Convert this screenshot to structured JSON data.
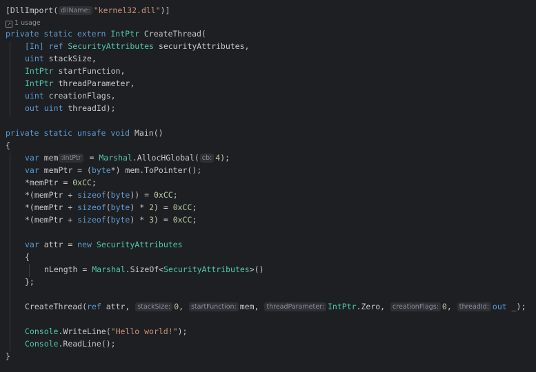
{
  "editor": {
    "attr_open": "[DllImport(",
    "hint_dllname": "dllName:",
    "dll_string": "\"kernel32.dll\"",
    "attr_close": ")]",
    "usage_text": "1 usage",
    "kw_private": "private",
    "kw_static": "static",
    "kw_extern": "extern",
    "kw_unsafe": "unsafe",
    "kw_void": "void",
    "kw_var": "var",
    "kw_ref": "ref",
    "kw_uint": "uint",
    "kw_out": "out",
    "kw_byte": "byte",
    "kw_sizeof": "sizeof",
    "kw_new": "new",
    "type_intptr": "IntPtr",
    "type_security": "SecurityAttributes",
    "type_marshal": "Marshal",
    "type_console": "Console",
    "create_thread_decl": " CreateThread(",
    "in_attr": "[In]",
    "p_security": " securityAttributes,",
    "p_stacksize": " stackSize,",
    "p_startfunction": " startFunction,",
    "p_threadparameter": " threadParameter,",
    "p_creationflags": " creationFlags,",
    "p_threadid": " threadId);",
    "main_sig": " Main()",
    "brace_open": "{",
    "brace_close": "}",
    "mem_name": " mem",
    "hint_intptr": ":IntPtr",
    "eq": " = ",
    "alloc_call": ".AllocHGlobal(",
    "hint_cb": "cb:",
    "num_4": "4",
    "close_semi": ");",
    "memptr_name": " memPtr = (",
    "memptr_rest": "*) mem.ToPointer();",
    "deref_line1": "*memPtr = ",
    "hex_cc": "0xCC",
    "semi": ";",
    "deref_open": "*(memPtr + ",
    "paren_open": "(",
    "paren_close_mul": ") * ",
    "num_2": "2",
    "num_3": "3",
    "paren_close2": ")) = ",
    "paren_close_eq": ") = ",
    "attr_decl": " attr = ",
    "nlength": "nLength = ",
    "sizeof_call": ".SizeOf<",
    "sizeof_close": ">()",
    "struct_close": "};",
    "ct_call": "CreateThread(",
    "ct_attr": " attr, ",
    "hint_stacksize": "stackSize:",
    "num_0": "0",
    "comma_sp": ", ",
    "hint_startfunction": "startFunction:",
    "mem_arg": "mem",
    "hint_threadparameter": "threadParameter:",
    "zero_member": ".Zero",
    "hint_creationflags": "creationFlags:",
    "hint_threadid": "threadId:",
    "discard_close": " _);",
    "writeline_call": ".WriteLine(",
    "hello_string": "\"Hello world!\"",
    "readline_call": ".ReadLine();",
    "space": " "
  }
}
